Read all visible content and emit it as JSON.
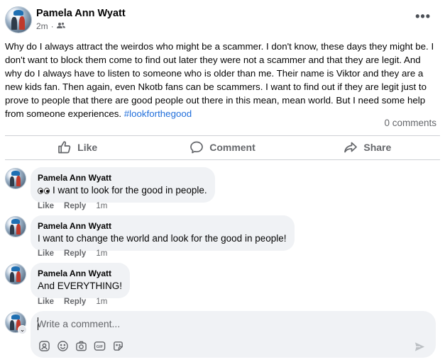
{
  "post": {
    "author": "Pamela Ann Wyatt",
    "time": "2m",
    "separator": "·",
    "audience_icon": "friends-icon",
    "more_icon": "more-options-icon",
    "text": "Why do I always attract the weirdos who might be a scammer.  I don't know, these days they might be.  I don't want to block them come to find out later they were not a scammer and that they are legit.  And why do I always have to listen to someone who is older than me.  Their name is Viktor and they are a new kids fan.  Then again, even Nkotb fans can be scammers.  I want to find out if they are legit just to prove to people that there are good people out there in this mean, mean world.  But I need some help from someone experiences. ",
    "hashtag": "#lookforthegood",
    "comment_count": "0 comments"
  },
  "actions": {
    "like": "Like",
    "comment": "Comment",
    "share": "Share"
  },
  "comments": [
    {
      "author": "Pamela Ann Wyatt",
      "text": "I want to look for the good in people.",
      "emoji": "eyes-emoji",
      "like": "Like",
      "reply": "Reply",
      "time": "1m"
    },
    {
      "author": "Pamela Ann Wyatt",
      "text": "I want to change the world and look for the good in people!",
      "like": "Like",
      "reply": "Reply",
      "time": "1m"
    },
    {
      "author": "Pamela Ann Wyatt",
      "text": "And EVERYTHING!",
      "like": "Like",
      "reply": "Reply",
      "time": "1m"
    }
  ],
  "composer": {
    "placeholder": "Write a comment...",
    "value": "",
    "gif_label": "GIF"
  },
  "colors": {
    "hashtag": "#216fdb",
    "secondary_text": "#65676b",
    "bubble": "#f0f2f5"
  }
}
